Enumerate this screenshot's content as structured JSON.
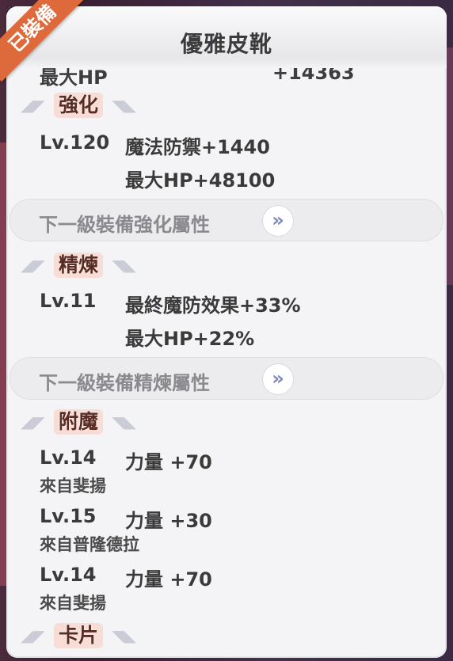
{
  "equipped_badge": "已裝備",
  "item_name": "優雅皮靴",
  "base_stat": {
    "label": "最大HP",
    "value": "+14363"
  },
  "enhance": {
    "title": "強化",
    "level": "Lv.120",
    "stats": [
      "魔法防禦+1440",
      "最大HP+48100"
    ],
    "next_label": "下一級裝備強化屬性"
  },
  "refine": {
    "title": "精煉",
    "level": "Lv.11",
    "stats": [
      "最終魔防效果+33%",
      "最大HP+22%"
    ],
    "next_label": "下一級裝備精煉屬性"
  },
  "enchant": {
    "title": "附魔",
    "entries": [
      {
        "level": "Lv.14",
        "stat": "力量 +70",
        "source": "來自斐揚"
      },
      {
        "level": "Lv.15",
        "stat": "力量 +30",
        "source": "來自普隆德拉"
      },
      {
        "level": "Lv.14",
        "stat": "力量 +70",
        "source": "來自斐揚"
      }
    ]
  },
  "card": {
    "title": "卡片"
  },
  "icons": {
    "next": "double-chevron-right-icon",
    "wing": "wing-ornament-icon"
  }
}
